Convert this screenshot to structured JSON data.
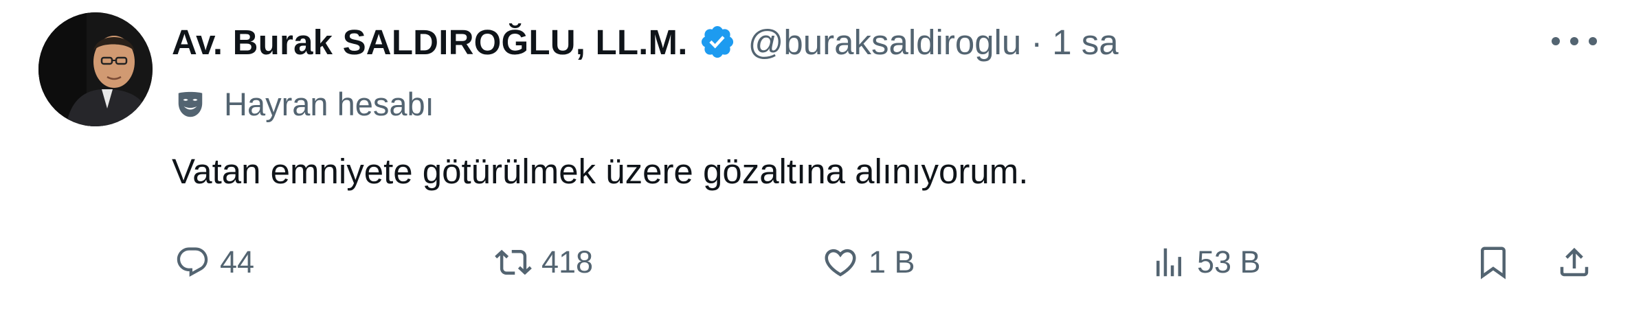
{
  "author": {
    "display_name": "Av. Burak SALDIROĞLU, LL.M.",
    "handle": "@buraksaldiroglu",
    "separator": "·",
    "time": "1 sa",
    "verified_color": "#1d9bf0",
    "fan_label": "Hayran hesabı",
    "fan_icon": "theater-masks-icon"
  },
  "tweet": {
    "text": "Vatan emniyete götürülmek üzere gözaltına alınıyorum."
  },
  "actions": {
    "replies": "44",
    "retweets": "418",
    "likes": "1 B",
    "views": "53 B"
  },
  "colors": {
    "text_primary": "#0f1419",
    "text_secondary": "#536471",
    "accent": "#1d9bf0"
  }
}
